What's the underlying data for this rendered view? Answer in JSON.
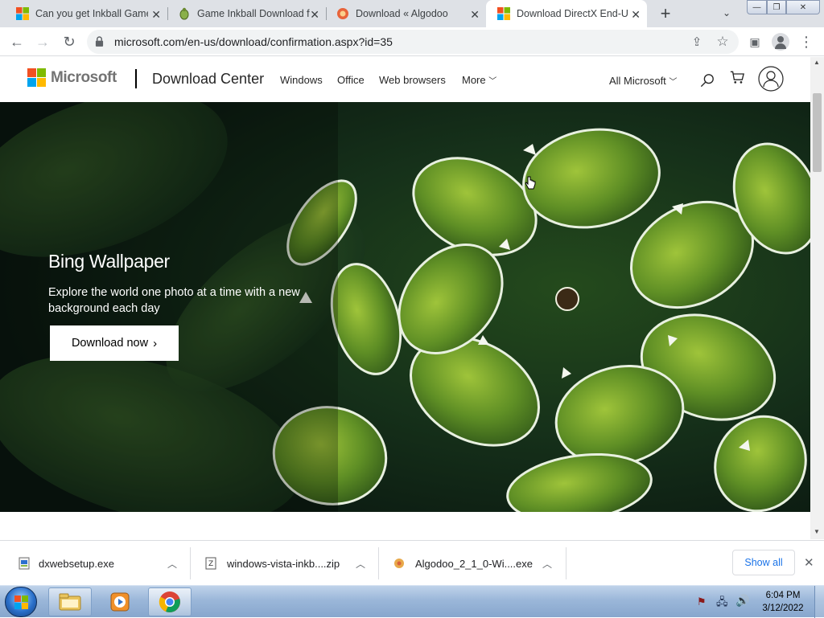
{
  "browser": {
    "tabs": [
      {
        "title": "Can you get Inkball Game",
        "favicon": "windows-logo-icon"
      },
      {
        "title": "Game Inkball Download f",
        "favicon": "bug-icon"
      },
      {
        "title": "Download « Algodoo",
        "favicon": "algodoo-icon"
      },
      {
        "title": "Download DirectX End-U",
        "favicon": "microsoft-logo-icon"
      }
    ],
    "new_tab_label": "+",
    "address_bar": {
      "url": "microsoft.com/en-us/download/confirmation.aspx?id=35"
    }
  },
  "site": {
    "brand": "Microsoft",
    "section": "Download Center",
    "nav": [
      "Windows",
      "Office",
      "Web browsers",
      "More"
    ],
    "all_microsoft": "All Microsoft"
  },
  "hero": {
    "title": "Bing Wallpaper",
    "subtitle": "Explore the world one photo at a time with a new background each day",
    "cta": "Download now"
  },
  "downloads": {
    "items": [
      {
        "name": "dxwebsetup.exe"
      },
      {
        "name": "windows-vista-inkb....zip"
      },
      {
        "name": "Algodoo_2_1_0-Wi....exe"
      }
    ],
    "show_all": "Show all"
  },
  "taskbar": {
    "time": "6:04 PM",
    "date": "3/12/2022"
  },
  "colors": {
    "ms_red": "#f25022",
    "ms_green": "#7fba00",
    "ms_blue": "#00a4ef",
    "ms_yellow": "#ffb900"
  }
}
